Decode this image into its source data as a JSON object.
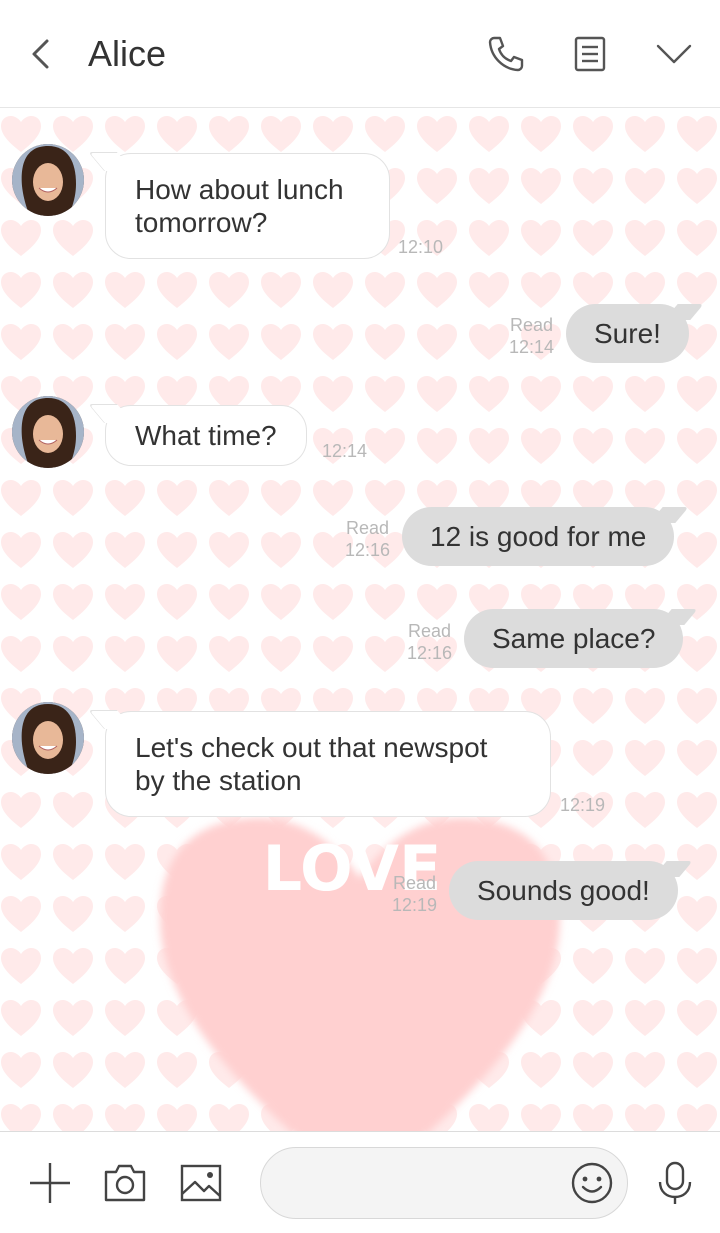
{
  "header": {
    "title": "Alice",
    "icons": [
      "back-icon",
      "phone-icon",
      "notes-icon",
      "chevron-down-icon"
    ]
  },
  "background": {
    "pattern": "pink-hearts",
    "big_heart_text": "LOVE",
    "heart_color": "#ffd0d0",
    "pattern_color": "#ffeaea"
  },
  "messages": [
    {
      "side": "in",
      "text": "How about lunch\ntomorrow?",
      "time": "12:10"
    },
    {
      "side": "out",
      "text": "Sure!",
      "status": "Read",
      "time": "12:14"
    },
    {
      "side": "in",
      "text": "What time?",
      "time": "12:14"
    },
    {
      "side": "out",
      "text": "12 is good for me",
      "status": "Read",
      "time": "12:16"
    },
    {
      "side": "out",
      "text": "Same place?",
      "status": "Read",
      "time": "12:16"
    },
    {
      "side": "in",
      "text": "Let's check out that newspot\nby the station",
      "time": "12:19"
    },
    {
      "side": "out",
      "text": "Sounds good!",
      "status": "Read",
      "time": "12:19"
    }
  ],
  "bottom": {
    "input_value": "",
    "icons": [
      "plus-icon",
      "camera-icon",
      "image-icon",
      "emoji-icon",
      "mic-icon"
    ]
  },
  "colors": {
    "outgoing_bubble": "#dcdcdc",
    "incoming_bubble": "#ffffff",
    "meta_text": "#b8b8b8"
  }
}
